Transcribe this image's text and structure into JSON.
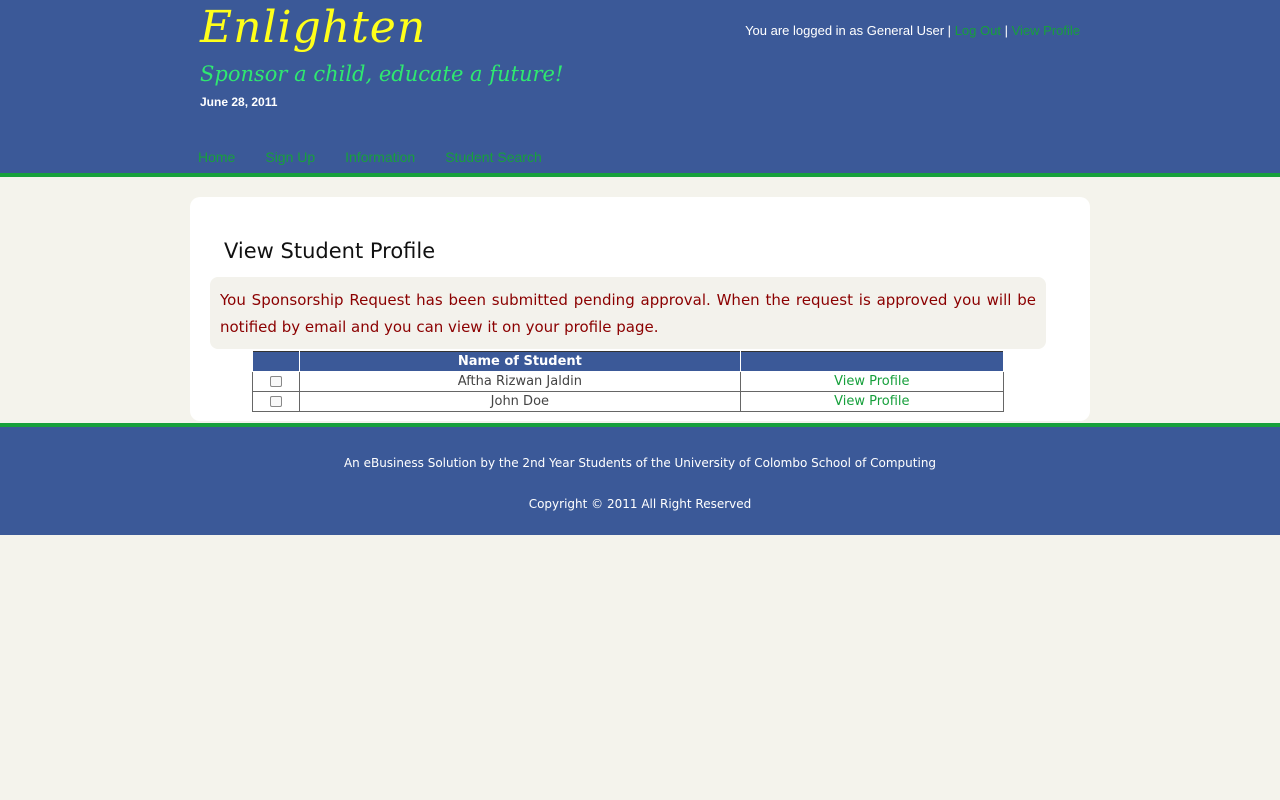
{
  "header": {
    "logo": "Enlighten",
    "tagline": "Sponsor a child, educate a future!",
    "date": "June 28, 2011",
    "user_text": "You are logged in as General User",
    "logout": "Log Out",
    "view_profile": "View Profile",
    "separator": "|"
  },
  "nav": [
    {
      "label": "Home"
    },
    {
      "label": "Sign Up"
    },
    {
      "label": "Information"
    },
    {
      "label": "Student Search"
    }
  ],
  "main": {
    "title": "View Student Profile",
    "notice": "You Sponsorship Request has been submitted pending approval. When the request is approved you will be notified by email and you can view it on your profile page.",
    "table": {
      "headers": [
        "",
        "Name of Student",
        ""
      ],
      "rows": [
        {
          "name": "Aftha Rizwan Jaldin",
          "action": "View Profile"
        },
        {
          "name": "John Doe",
          "action": "View Profile"
        }
      ]
    }
  },
  "footer": {
    "line1": "An eBusiness Solution by the 2nd Year Students of the University of Colombo School of Computing",
    "line2": "Copyright © 2011 All Right Reserved"
  },
  "colors": {
    "header_bg": "#3b5998",
    "accent_green": "#17a03c",
    "logo_yellow": "#ffff1a",
    "notice_text": "#8b0000"
  }
}
